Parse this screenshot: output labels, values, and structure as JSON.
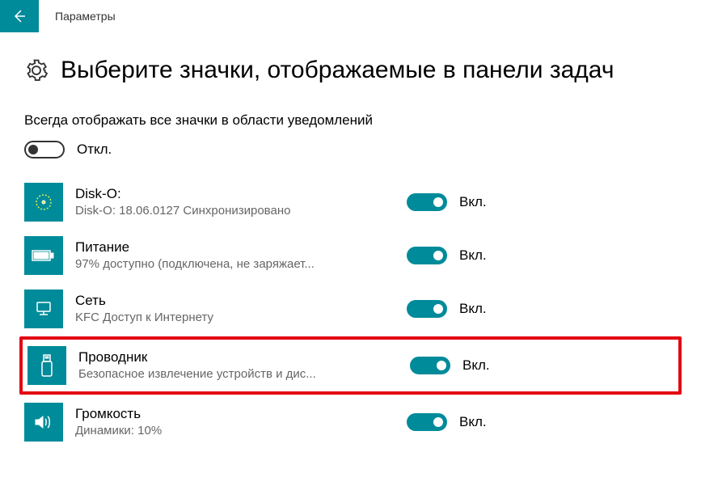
{
  "titlebar": {
    "text": "Параметры"
  },
  "header": {
    "title": "Выберите значки, отображаемые в панели задач"
  },
  "master": {
    "label": "Всегда отображать все значки в области уведомлений",
    "toggle_label": "Откл.",
    "state": "off"
  },
  "items": [
    {
      "title": "Disk-O:",
      "desc": "Disk-O: 18.06.0127 Синхронизировано",
      "toggle_label": "Вкл.",
      "state": "on",
      "icon": "disk-o",
      "highlighted": false
    },
    {
      "title": "Питание",
      "desc": "97% доступно (подключена, не заряжает...",
      "toggle_label": "Вкл.",
      "state": "on",
      "icon": "battery",
      "highlighted": false
    },
    {
      "title": "Сеть",
      "desc": "KFC Доступ к Интернету",
      "toggle_label": "Вкл.",
      "state": "on",
      "icon": "network",
      "highlighted": false
    },
    {
      "title": "Проводник",
      "desc": "Безопасное извлечение устройств и дис...",
      "toggle_label": "Вкл.",
      "state": "on",
      "icon": "usb",
      "highlighted": true
    },
    {
      "title": "Громкость",
      "desc": "Динамики: 10%",
      "toggle_label": "Вкл.",
      "state": "on",
      "icon": "volume",
      "highlighted": false
    }
  ]
}
